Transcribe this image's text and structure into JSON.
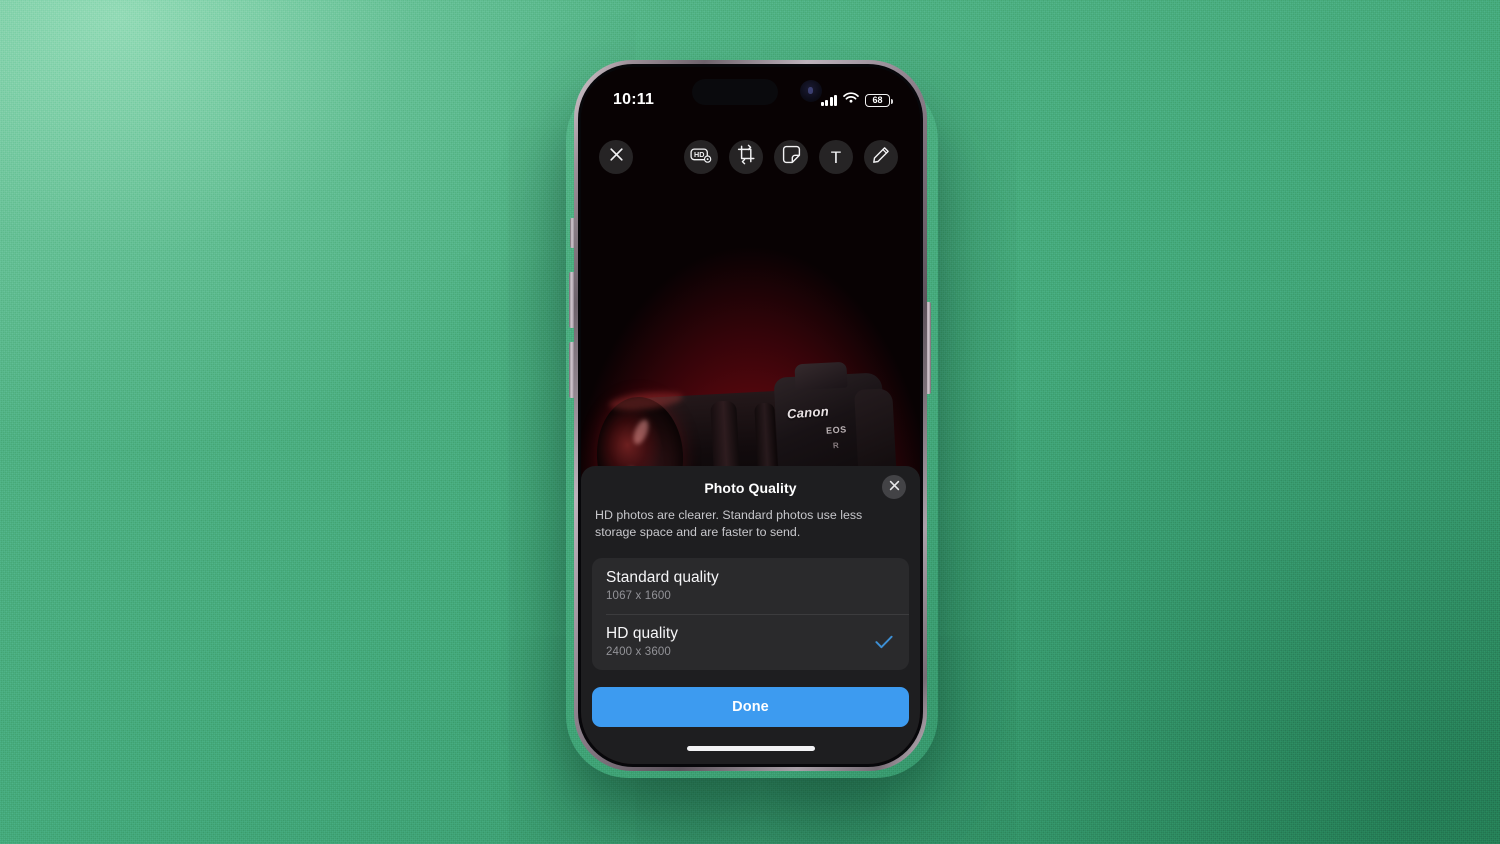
{
  "background": {
    "color": "#44a97b",
    "description": "green textured paper backdrop"
  },
  "device": {
    "frame_color": "#9c8f98",
    "buttons": [
      {
        "name": "silent-switch"
      },
      {
        "name": "volume-up-button"
      },
      {
        "name": "volume-down-button"
      },
      {
        "name": "power-button"
      }
    ]
  },
  "status_bar": {
    "time": "10:11",
    "cellular_icon": "signal-bars-icon",
    "wifi_icon": "wifi-icon",
    "battery_level": "68",
    "battery_icon": "battery-icon"
  },
  "editor_toolbar": {
    "close": {
      "icon": "close-icon",
      "label": ""
    },
    "tools": [
      {
        "icon": "hd-icon",
        "label": "HD",
        "name": "hd-quality-button"
      },
      {
        "icon": "crop-rotate-icon",
        "label": "",
        "name": "crop-rotate-button"
      },
      {
        "icon": "sticker-icon",
        "label": "",
        "name": "sticker-button"
      },
      {
        "icon": "text-icon",
        "label": "T",
        "name": "text-button"
      },
      {
        "icon": "pencil-icon",
        "label": "",
        "name": "draw-button"
      }
    ]
  },
  "photo": {
    "subject": "Canon EOS DSLR camera",
    "brand_text": "Canon",
    "model_text": "EOS",
    "model_number": "R",
    "lighting": "red"
  },
  "sheet": {
    "title": "Photo Quality",
    "close_icon": "close-icon",
    "description": "HD photos are clearer. Standard photos use less storage space and are faster to send.",
    "options": [
      {
        "title": "Standard quality",
        "subtitle": "1067 x 1600",
        "selected": false
      },
      {
        "title": "HD quality",
        "subtitle": "2400 x 3600",
        "selected": true
      }
    ],
    "done_label": "Done",
    "accent_color": "#3d9bf0",
    "check_color": "#3d8fd4"
  },
  "home_indicator": {
    "visible": true
  }
}
